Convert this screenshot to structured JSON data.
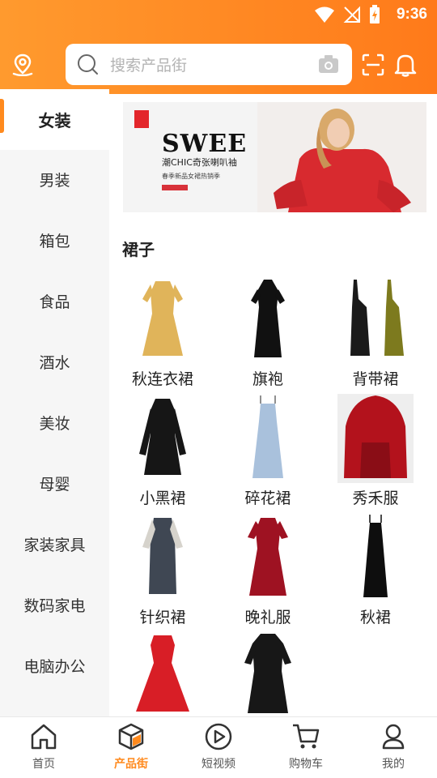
{
  "status_bar": {
    "time": "9:36"
  },
  "search": {
    "placeholder": "搜索产品街"
  },
  "sidebar": {
    "items": [
      {
        "label": "女装",
        "active": true
      },
      {
        "label": "男装"
      },
      {
        "label": "箱包"
      },
      {
        "label": "食品"
      },
      {
        "label": "酒水"
      },
      {
        "label": "美妆"
      },
      {
        "label": "母婴"
      },
      {
        "label": "家装家具"
      },
      {
        "label": "数码家电"
      },
      {
        "label": "电脑办公"
      }
    ]
  },
  "banner": {
    "brand": "SWEE",
    "tagline": "潮CHIC奇张喇叭袖",
    "sub": "春季新品女裙热销季"
  },
  "section": {
    "title": "裙子"
  },
  "products": [
    {
      "label": "秋连衣裙",
      "color": "#e0b45a"
    },
    {
      "label": "旗袍",
      "color": "#111111"
    },
    {
      "label": "背带裙",
      "color": "#1a1a1a"
    },
    {
      "label": "小黑裙",
      "color": "#161616"
    },
    {
      "label": "碎花裙",
      "color": "#a9c1dc"
    },
    {
      "label": "秀禾服",
      "color": "#b3121c"
    },
    {
      "label": "针织裙",
      "color": "#3f4753"
    },
    {
      "label": "晚礼服",
      "color": "#9e1222"
    },
    {
      "label": "秋裙",
      "color": "#0e0e0e"
    },
    {
      "label": "",
      "color": "#d81e26"
    },
    {
      "label": "",
      "color": "#171717"
    }
  ],
  "bottom_nav": [
    {
      "label": "首页",
      "icon": "home-icon"
    },
    {
      "label": "产品街",
      "icon": "box-icon",
      "active": true
    },
    {
      "label": "短视频",
      "icon": "play-icon"
    },
    {
      "label": "购物车",
      "icon": "cart-icon"
    },
    {
      "label": "我的",
      "icon": "user-icon"
    }
  ],
  "colors": {
    "accent": "#ff8a1e",
    "header_start": "#ff9a2e",
    "header_end": "#ff7a1a"
  }
}
